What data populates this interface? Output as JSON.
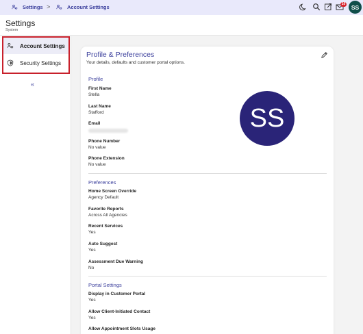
{
  "breadcrumb": {
    "items": [
      {
        "label": "Settings",
        "icon": "users-gear-icon"
      },
      {
        "label": "Account Settings",
        "icon": "users-gear-icon"
      }
    ],
    "separator": ">"
  },
  "topbar": {
    "icons": [
      "moon-icon",
      "search-icon",
      "external-link-icon",
      "mail-icon"
    ],
    "mail_badge": "10",
    "avatar_initials": "SS"
  },
  "page": {
    "title": "Settings",
    "subtitle": "System"
  },
  "sidebar": {
    "items": [
      {
        "label": "Account Settings",
        "icon": "users-gear-icon",
        "active": true
      },
      {
        "label": "Security Settings",
        "icon": "shield-icon",
        "active": false
      }
    ],
    "collapse_label": "«"
  },
  "card": {
    "title": "Profile & Preferences",
    "subtitle": "Your details, defaults and customer portal options.",
    "avatar_initials": "SS"
  },
  "profile": {
    "title": "Profile",
    "fields": [
      {
        "label": "First Name",
        "value": "Stella"
      },
      {
        "label": "Last Name",
        "value": "Stafford"
      },
      {
        "label": "Email",
        "value": ""
      },
      {
        "label": "Phone Number",
        "value": "No value"
      },
      {
        "label": "Phone Extension",
        "value": "No value"
      }
    ]
  },
  "preferences": {
    "title": "Preferences",
    "fields": [
      {
        "label": "Home Screen Override",
        "value": "Agency Default"
      },
      {
        "label": "Favorite Reports",
        "value": "Across All Agencies"
      },
      {
        "label": "Recent Services",
        "value": "Yes"
      },
      {
        "label": "Auto Suggest",
        "value": "Yes"
      },
      {
        "label": "Assessment Due Warning",
        "value": "No"
      }
    ]
  },
  "portal": {
    "title": "Portal Settings",
    "fields": [
      {
        "label": "Display in Customer Portal",
        "value": "Yes"
      },
      {
        "label": "Allow Client-Initiated Contact",
        "value": "Yes"
      },
      {
        "label": "Allow Appointment Slots Usage",
        "value": ""
      }
    ]
  },
  "colors": {
    "accent": "#3b3f9c",
    "highlight_border": "#c8202b",
    "avatar_bg": "#2a2478",
    "avatar_small_bg": "#0f4e4a",
    "badge": "#d8262f"
  }
}
